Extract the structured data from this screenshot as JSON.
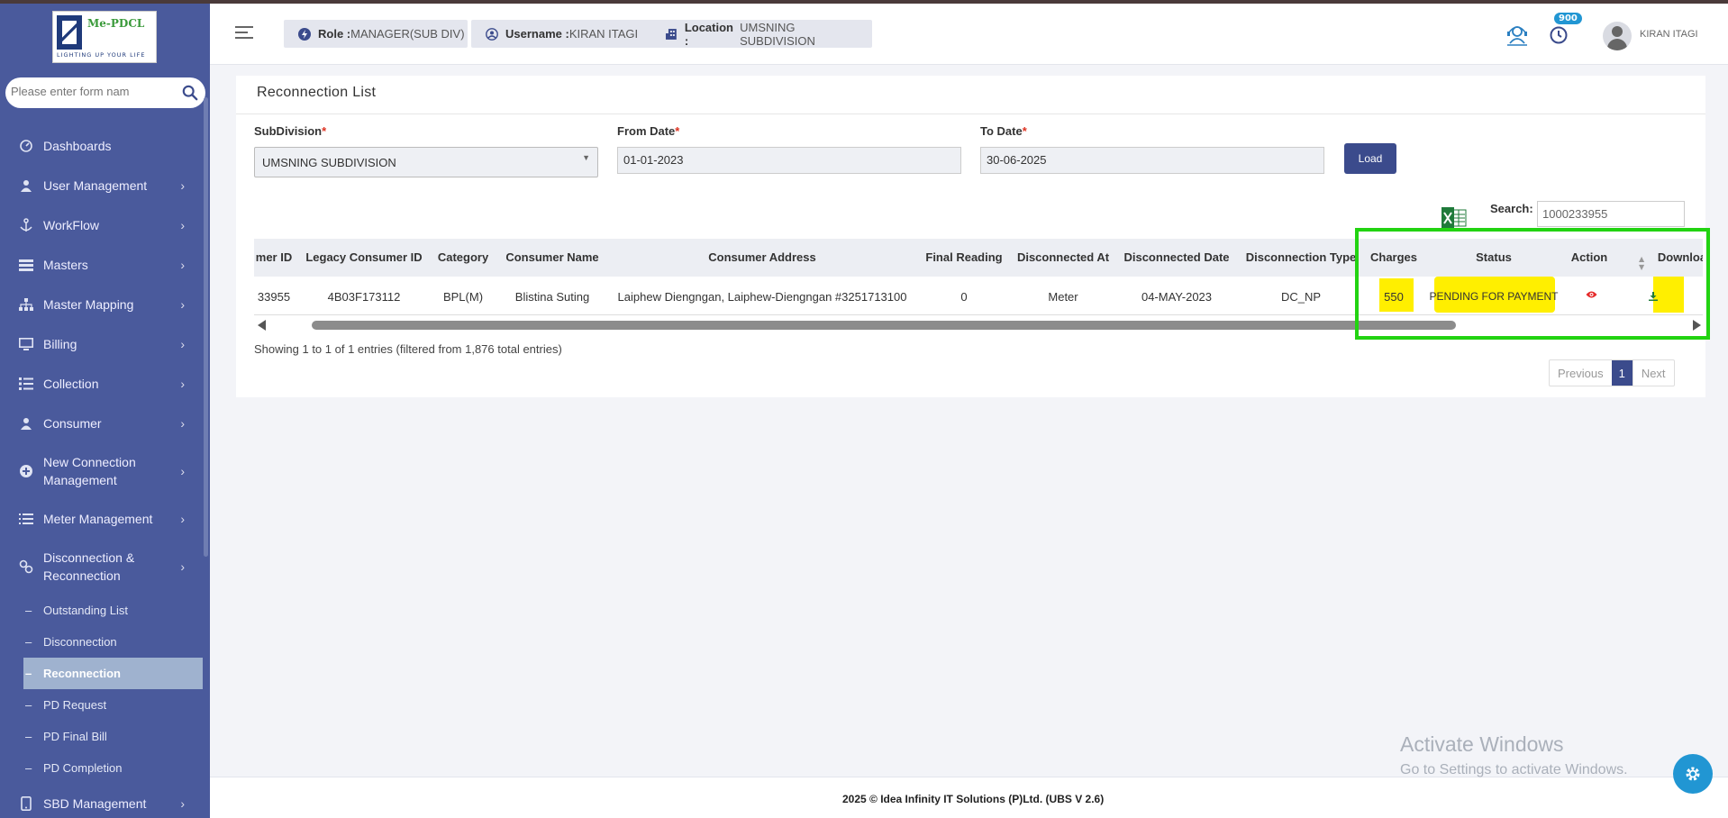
{
  "app": {
    "logo_brand": "Me-PDCL",
    "logo_tagline": "LIGHTING UP YOUR LIFE"
  },
  "sidebar": {
    "search_placeholder": "Please enter form nam",
    "items": [
      {
        "label": "Dashboards",
        "icon": "dashboard-icon",
        "has_children": false
      },
      {
        "label": "User Management",
        "icon": "user-icon",
        "has_children": true
      },
      {
        "label": "WorkFlow",
        "icon": "anchor-icon",
        "has_children": true
      },
      {
        "label": "Masters",
        "icon": "list-icon",
        "has_children": true
      },
      {
        "label": "Master Mapping",
        "icon": "sitemap-icon",
        "has_children": true
      },
      {
        "label": "Billing",
        "icon": "monitor-icon",
        "has_children": true
      },
      {
        "label": "Collection",
        "icon": "list-check-icon",
        "has_children": true
      },
      {
        "label": "Consumer",
        "icon": "user-icon",
        "has_children": true
      },
      {
        "label": "New Connection Management",
        "icon": "plus-circle-icon",
        "has_children": true
      },
      {
        "label": "Meter Management",
        "icon": "list-icon",
        "has_children": true
      },
      {
        "label": "Disconnection & Reconnection",
        "icon": "link-icon",
        "has_children": true
      }
    ],
    "sub_items": [
      {
        "label": "Outstanding List",
        "active": false
      },
      {
        "label": "Disconnection",
        "active": false
      },
      {
        "label": "Reconnection",
        "active": true
      },
      {
        "label": "PD Request",
        "active": false
      },
      {
        "label": "PD Final Bill",
        "active": false
      },
      {
        "label": "PD Completion",
        "active": false
      }
    ],
    "bottom_item": {
      "label": "SBD Management",
      "icon": "phone-icon"
    }
  },
  "header": {
    "role_label": "Role :",
    "role_value": "MANAGER(SUB DIV)",
    "username_label": "Username :",
    "username_value": "KIRAN ITAGI",
    "location_label": "Location :",
    "location_value": "UMSNING SUBDIVISION",
    "notification_count": "900",
    "user_name": "KIRAN ITAGI"
  },
  "page": {
    "title": "Reconnection List",
    "subdivision_label": "SubDivision",
    "subdivision_value": "UMSNING SUBDIVISION",
    "from_date_label": "From Date",
    "from_date_value": "01-01-2023",
    "to_date_label": "To Date",
    "to_date_value": "30-06-2025",
    "required_mark": "*",
    "load_label": "Load",
    "search_label": "Search:",
    "search_value": "1000233955"
  },
  "table": {
    "columns": [
      "mer ID",
      "Legacy Consumer ID",
      "Category",
      "Consumer Name",
      "Consumer Address",
      "Final Reading",
      "Disconnected At",
      "Disconnected Date",
      "Disconnection Type",
      "Charges",
      "Status",
      "Action",
      "Downloa"
    ],
    "rows": [
      [
        "33955",
        "4B03F173112",
        "BPL(M)",
        "Blistina Suting",
        "Laiphew Diengngan, Laiphew-Diengngan #3251713100",
        "0",
        "Meter",
        "04-MAY-2023",
        "DC_NP",
        "550",
        "PENDING FOR PAYMENT",
        "",
        ""
      ]
    ]
  },
  "footer_info": {
    "entries_text": "Showing 1 to 1 of 1 entries (filtered from 1,876 total entries)",
    "prev_label": "Previous",
    "current_page": "1",
    "next_label": "Next"
  },
  "footer": {
    "copyright": "2025 © Idea Infinity IT Solutions (P)Ltd. (UBS V 2.6)"
  },
  "watermark": {
    "line1": "Activate Windows",
    "line2": "Go to Settings to activate Windows."
  },
  "colors": {
    "sidebar_bg": "#4a5a9c",
    "primary": "#3b4b8c",
    "highlight": "#ffef00",
    "annotation_box": "#22d311",
    "badge": "#2196d3"
  }
}
